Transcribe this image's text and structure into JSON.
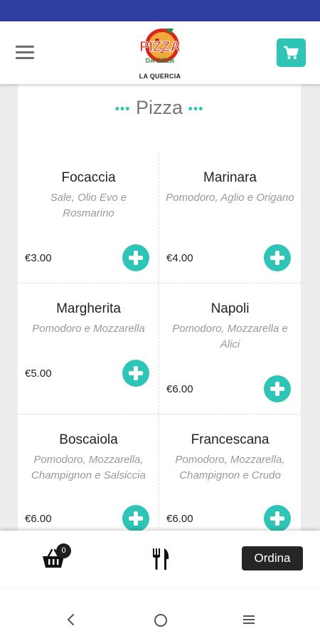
{
  "header": {
    "menu_icon": "hamburger-menu-icon",
    "logo": {
      "line1": "PIZZA",
      "line2": "DA ZIZZA",
      "subtitle": "LA QUERCIA"
    },
    "cart_icon": "shopping-cart-icon"
  },
  "section": {
    "dots_left": "•••",
    "title": "Pizza",
    "dots_right": "•••"
  },
  "items": [
    {
      "name": "Focaccia",
      "description": "Sale, Olio Evo e Rosmarino",
      "price": "€3.00"
    },
    {
      "name": "Marinara",
      "description": "Pomodoro, Aglio e Origano",
      "price": "€4.00"
    },
    {
      "name": "Margherita",
      "description": "Pomodoro e Mozzarella",
      "price": "€5.00"
    },
    {
      "name": "Napoli",
      "description": "Pomodoro, Mozzarella e Alici",
      "price": "€6.00"
    },
    {
      "name": "Boscaiola",
      "description": "Pomodoro, Mozzarella, Champignon e Salsiccia",
      "price": "€6.00"
    },
    {
      "name": "Francescana",
      "description": "Pomodoro, Mozzarella, Champignon e Crudo",
      "price": "€6.00"
    }
  ],
  "bottom_bar": {
    "basket_icon": "basket-icon",
    "basket_count": "0",
    "cutlery_icon": "fork-knife-icon",
    "order_label": "Ordina"
  },
  "colors": {
    "accent": "#2ec4b6",
    "status_bar": "#303f9f",
    "dark_button": "#262626"
  }
}
